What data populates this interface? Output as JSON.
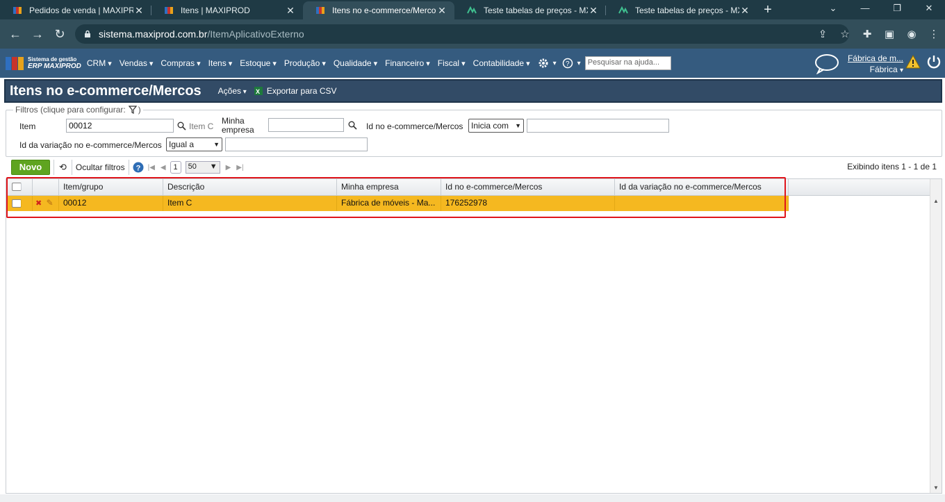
{
  "browser": {
    "tabs": [
      {
        "title": "Pedidos de venda | MAXIPRO",
        "active": false
      },
      {
        "title": "Itens | MAXIPROD",
        "active": false
      },
      {
        "title": "Itens no e-commerce/Merco",
        "active": true
      },
      {
        "title": "Teste tabelas de preços - MX",
        "active": false
      },
      {
        "title": "Teste tabelas de preços - MX",
        "active": false
      }
    ],
    "url_host": "sistema.maxiprod.com.br",
    "url_path": "/ItemAplicativoExterno"
  },
  "app": {
    "logo_line1": "Sistema de gestão",
    "logo_line2": "ERP MAXIPROD",
    "menu": [
      "CRM",
      "Vendas",
      "Compras",
      "Itens",
      "Estoque",
      "Produção",
      "Qualidade",
      "Financeiro",
      "Fiscal",
      "Contabilidade"
    ],
    "help_search_placeholder": "Pesquisar na ajuda...",
    "company_name": "Fábrica de m...",
    "company_unit": "Fábrica",
    "colors": {
      "nav": "#355b7f",
      "title": "#324b66",
      "row_selected": "#f5b820",
      "novo": "#5fa420",
      "highlight": "#e0141b"
    }
  },
  "page": {
    "title": "Itens no e-commerce/Mercos",
    "actions_label": "Ações",
    "export_label": "Exportar para CSV"
  },
  "filters": {
    "legend": "Filtros (clique para configurar:",
    "legend_close": ")",
    "item_label": "Item",
    "item_value": "00012",
    "item_desc": "Item C",
    "empresa_label_1": "Minha",
    "empresa_label_2": "empresa",
    "empresa_value": "",
    "ecommerce_id_label": "Id no e-commerce/Mercos",
    "ecommerce_id_op": "Inicia com",
    "ecommerce_id_value": "",
    "variacao_label": "Id da variação no e-commerce/Mercos",
    "variacao_op": "Igual a",
    "variacao_value": ""
  },
  "toolbar": {
    "novo": "Novo",
    "hide_filters": "Ocultar filtros",
    "page": "1",
    "page_size": "50",
    "showing": "Exibindo itens 1 - 1 de 1"
  },
  "grid": {
    "columns": [
      "Item/grupo",
      "Descrição",
      "Minha empresa",
      "Id no e-commerce/Mercos",
      "Id da variação no e-commerce/Mercos"
    ],
    "rows": [
      {
        "item": "00012",
        "descricao": "Item C",
        "empresa": "Fábrica de móveis - Ma...",
        "ecommerce_id": "176252978",
        "variacao_id": ""
      }
    ]
  }
}
